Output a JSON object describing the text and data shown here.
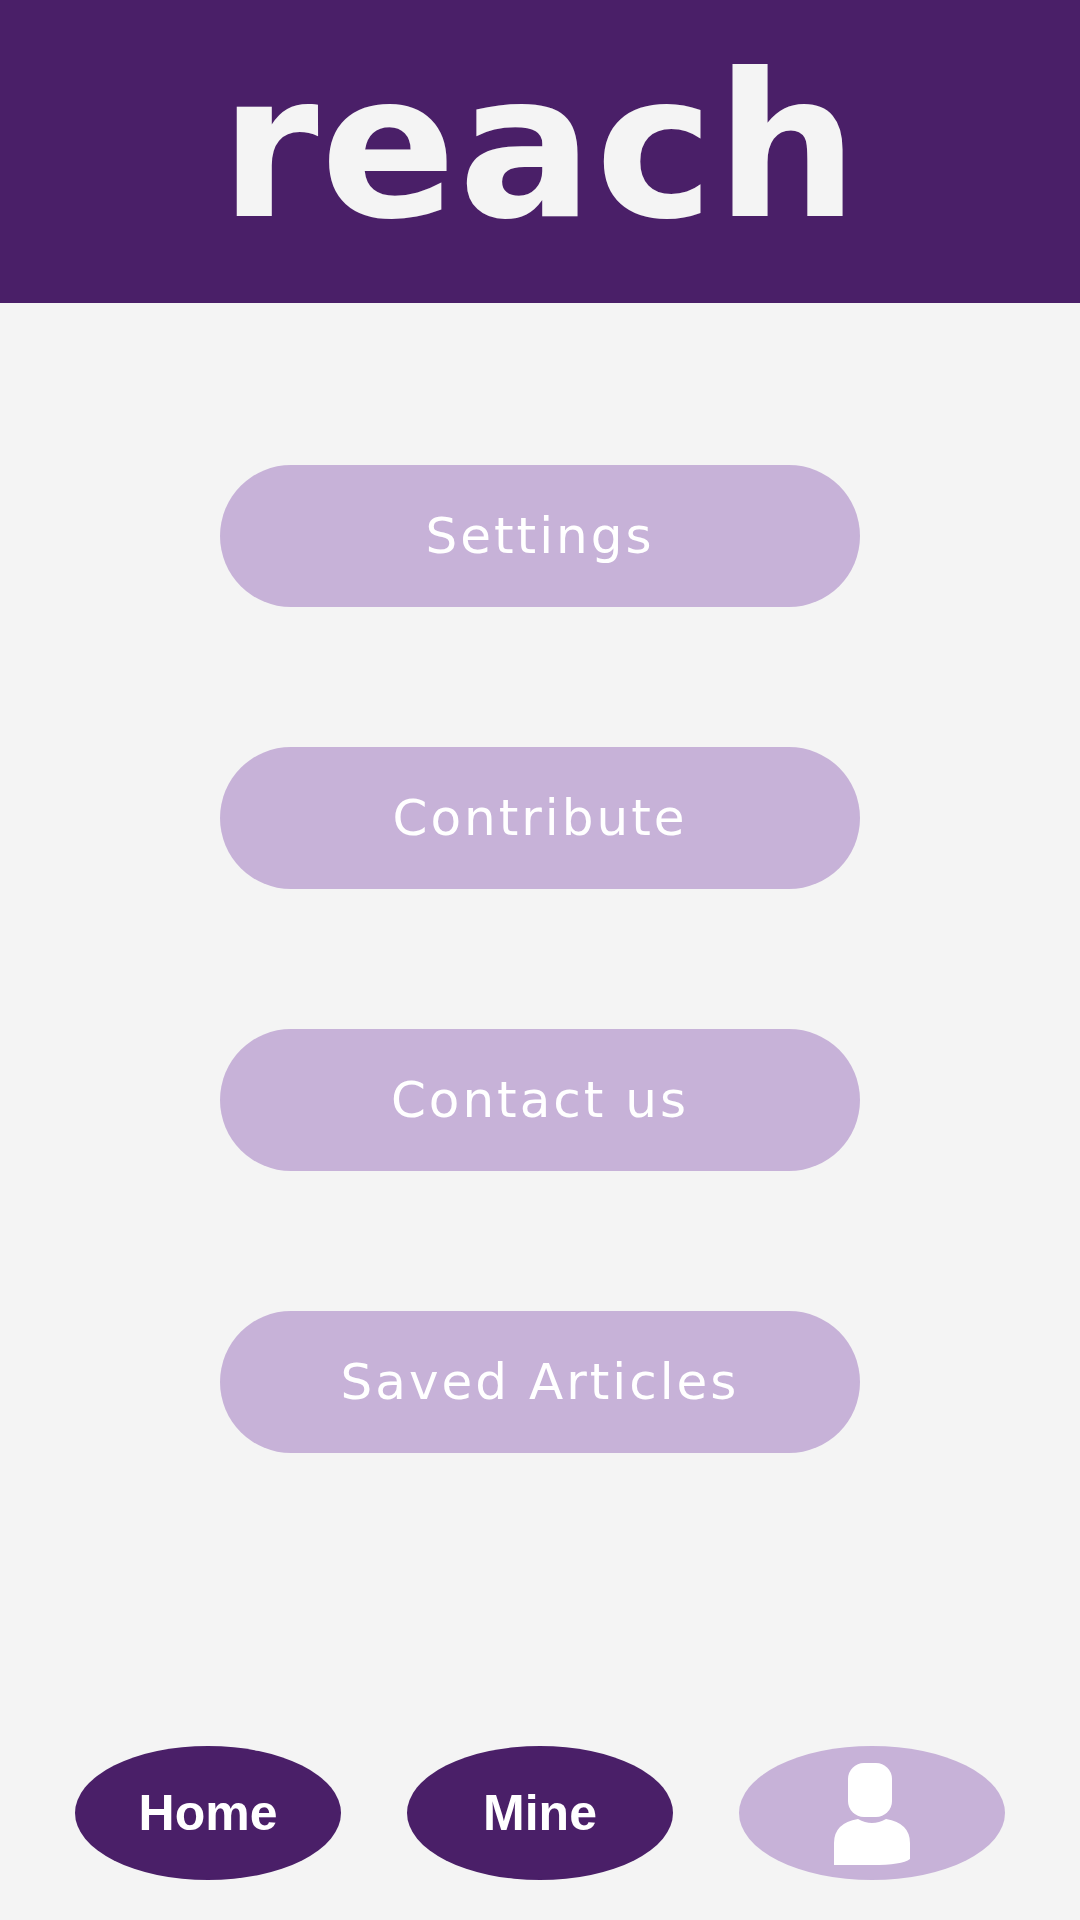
{
  "header": {
    "logo": "reach"
  },
  "menu": [
    "Settings",
    "Contribute",
    "Contact us",
    "Saved Articles"
  ],
  "nav": [
    {
      "kind": "label",
      "label": "Home",
      "selected": false
    },
    {
      "kind": "label",
      "label": "Mine",
      "selected": false
    },
    {
      "kind": "profile",
      "selected": true
    }
  ]
}
